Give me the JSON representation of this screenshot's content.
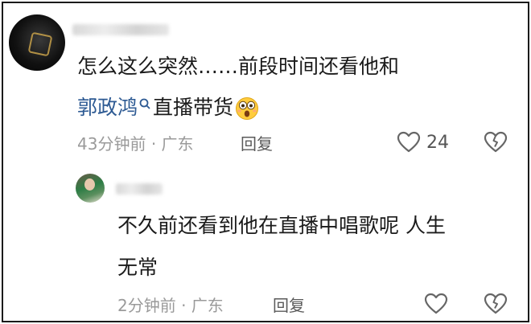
{
  "comment": {
    "text_line1": "怎么这么突然……前段时间还看他和",
    "link_name": "郭政鸿",
    "text_line2_rest": "直播带货",
    "emoji": "astonished-face-emoji",
    "time": "43分钟前",
    "separator": "·",
    "location": "广东",
    "reply_label": "回复",
    "like_count": "24"
  },
  "reply": {
    "text_line1": "不久前还看到他在直播中唱歌呢 人生",
    "text_line2": "无常",
    "time": "2分钟前",
    "separator": "·",
    "location": "广东",
    "reply_label": "回复"
  },
  "colors": {
    "text": "#1b1b1b",
    "link": "#2d5a93",
    "meta": "#9a9a9a"
  }
}
